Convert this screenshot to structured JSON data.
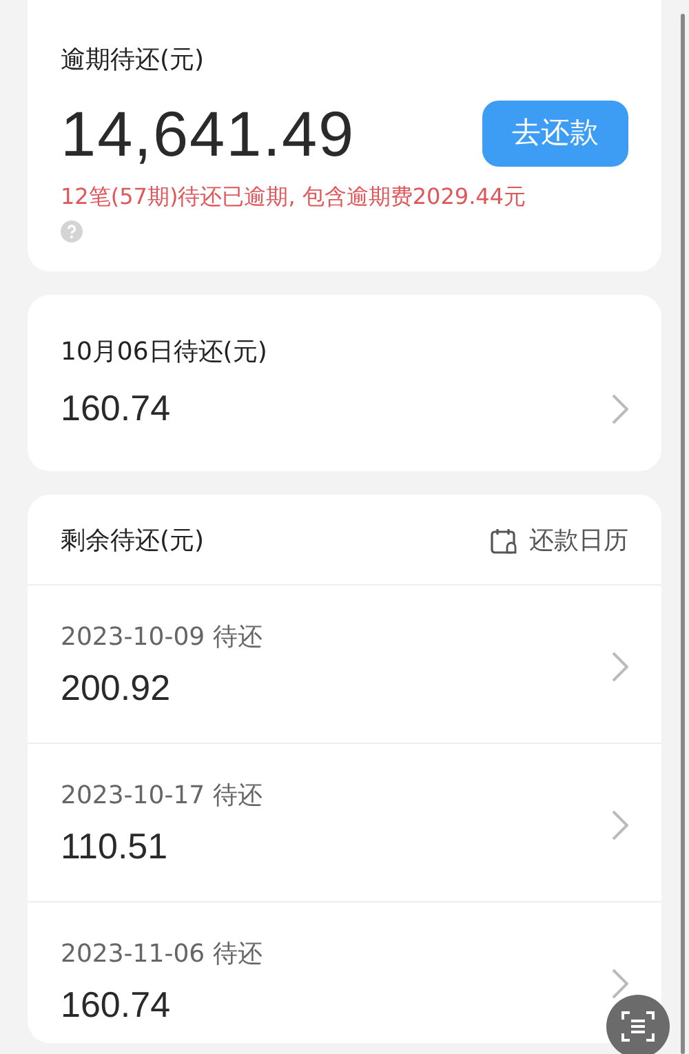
{
  "overdue": {
    "label": "逾期待还(元)",
    "amount": "14,641.49",
    "button": "去还款",
    "notice": "12笔(57期)待还已逾期, 包含逾期费2029.44元"
  },
  "next_due": {
    "label": "10月06日待还(元)",
    "amount": "160.74"
  },
  "remaining": {
    "label": "剩余待还(元)",
    "calendar_link": "还款日历",
    "items": [
      {
        "date": "2023-10-09 待还",
        "amount": "200.92"
      },
      {
        "date": "2023-10-17 待还",
        "amount": "110.51"
      },
      {
        "date": "2023-11-06 待还",
        "amount": "160.74"
      }
    ]
  }
}
